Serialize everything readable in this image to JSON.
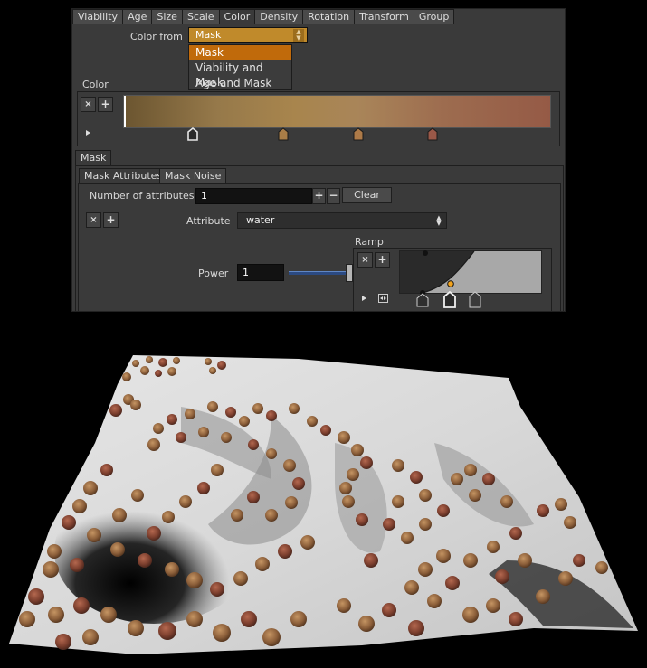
{
  "tabs": [
    "Viability",
    "Age",
    "Size",
    "Scale",
    "Color",
    "Density",
    "Rotation",
    "Transform",
    "Group"
  ],
  "active_tab": "Color",
  "color_from": {
    "label": "Color from",
    "value": "Mask",
    "options": [
      "Mask",
      "Viability and Mask",
      "Age and Mask"
    ],
    "selected_option": "Mask"
  },
  "color_section": {
    "label": "Color",
    "remove_label": "×",
    "add_label": "+",
    "gradient_colors": [
      "#6b5530",
      "#96794a",
      "#a8854d",
      "#a98559",
      "#9d6c4f",
      "#955a46"
    ],
    "stop_colors": [
      "#3a3a3a",
      "#a87d47",
      "#ad7a48",
      "#9a5848"
    ]
  },
  "mask": {
    "tab_label": "Mask",
    "subtabs": [
      "Mask Attributes",
      "Mask Noise"
    ],
    "active_subtab": "Mask Attributes",
    "num_attributes_label": "Number of attributes",
    "num_attributes_value": "1",
    "plus_label": "+",
    "minus_label": "−",
    "clear_label": "Clear",
    "remove_label": "×",
    "add_label": "+",
    "attribute_label": "Attribute",
    "attribute_value": "water",
    "power_label": "Power",
    "power_value": "1",
    "ramp_label": "Ramp"
  },
  "colors": {
    "accent": "#c08a2b",
    "selection": "#c06a0b",
    "panel_bg": "#3a3a3a"
  }
}
